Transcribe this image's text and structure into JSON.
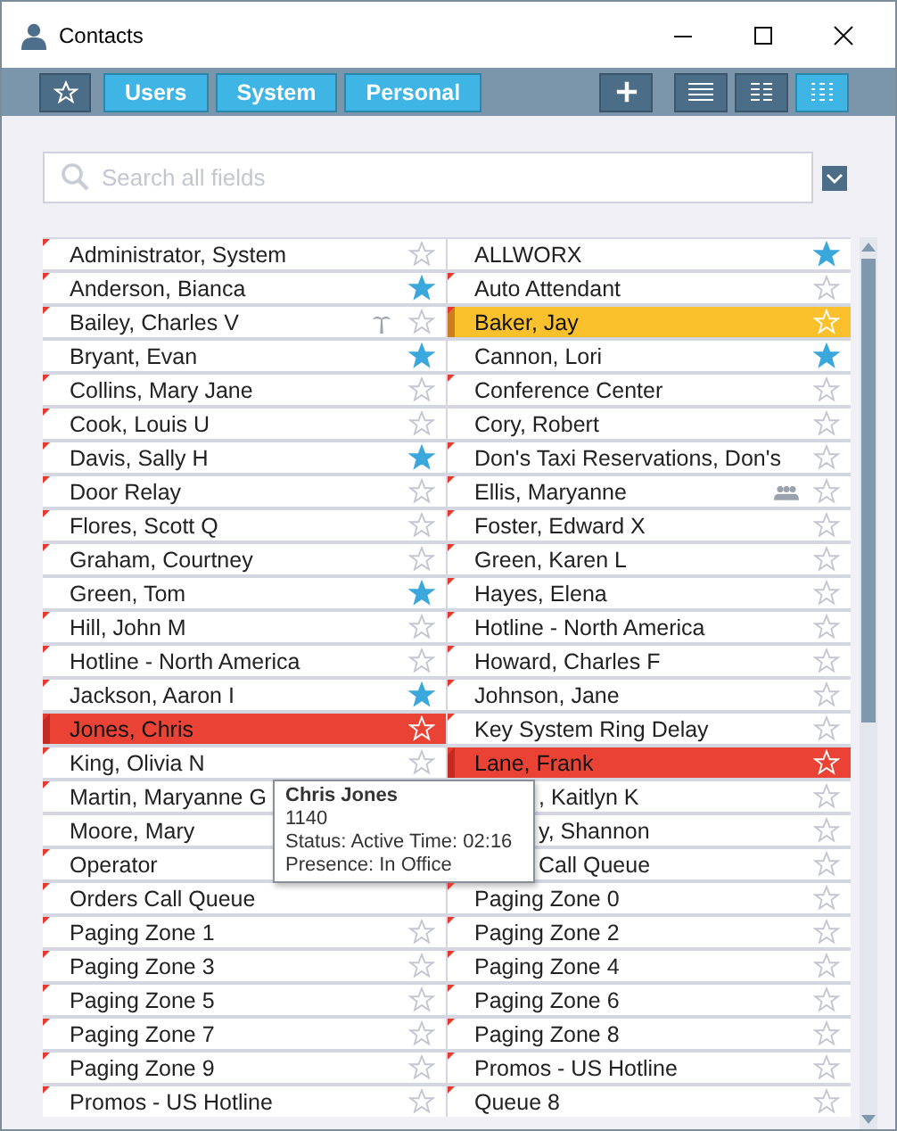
{
  "window": {
    "title": "Contacts"
  },
  "filters": {
    "favorites": {
      "selected": false
    },
    "tabs": [
      {
        "label": "Users",
        "selected": true
      },
      {
        "label": "System",
        "selected": true
      },
      {
        "label": "Personal",
        "selected": true
      }
    ]
  },
  "views": [
    {
      "kind": "list",
      "selected": false
    },
    {
      "kind": "details",
      "selected": false
    },
    {
      "kind": "grid",
      "selected": true
    }
  ],
  "search": {
    "placeholder": "Search all fields"
  },
  "columns": [
    {
      "rows": [
        {
          "name": "Administrator, System",
          "kind": "plain",
          "flag": true,
          "starred": false
        },
        {
          "name": "Anderson, Bianca",
          "kind": "plain",
          "flag": true,
          "starred": true
        },
        {
          "name": "Bailey, Charles V",
          "kind": "vacation",
          "flag": true,
          "starred": false
        },
        {
          "name": "Bryant, Evan",
          "kind": "plain",
          "flag": false,
          "starred": true
        },
        {
          "name": "Collins, Mary Jane",
          "kind": "plain",
          "flag": true,
          "starred": false
        },
        {
          "name": "Cook, Louis U",
          "kind": "plain",
          "flag": true,
          "starred": false
        },
        {
          "name": "Davis, Sally H",
          "kind": "plain",
          "flag": true,
          "starred": true
        },
        {
          "name": "Door Relay",
          "kind": "plain",
          "flag": true,
          "starred": false
        },
        {
          "name": "Flores, Scott Q",
          "kind": "plain",
          "flag": true,
          "starred": false
        },
        {
          "name": "Graham, Courtney",
          "kind": "plain",
          "flag": true,
          "starred": false
        },
        {
          "name": "Green, Tom",
          "kind": "plain",
          "flag": false,
          "starred": true
        },
        {
          "name": "Hill, John M",
          "kind": "plain",
          "flag": true,
          "starred": false
        },
        {
          "name": "Hotline - North America",
          "kind": "plain",
          "flag": true,
          "starred": false
        },
        {
          "name": "Jackson, Aaron I",
          "kind": "plain",
          "flag": true,
          "starred": true
        },
        {
          "name": "Jones, Chris",
          "kind": "plain",
          "flag": true,
          "color": "#ea4335",
          "starred": false
        },
        {
          "name": "King, Olivia N",
          "kind": "plain",
          "flag": true,
          "starred": false
        },
        {
          "name": "Martin, Maryanne G",
          "kind": "plain",
          "flag": true
        },
        {
          "name": "Moore, Mary",
          "kind": "plain",
          "flag": false
        },
        {
          "name": "Operator",
          "kind": "plain",
          "flag": true
        },
        {
          "name": "Orders Call Queue",
          "kind": "plain",
          "flag": true
        },
        {
          "name": "Paging Zone 1",
          "kind": "plain",
          "flag": true,
          "starred": false
        },
        {
          "name": "Paging Zone 3",
          "kind": "plain",
          "flag": true,
          "starred": false
        },
        {
          "name": "Paging Zone 5",
          "kind": "plain",
          "flag": true,
          "starred": false
        },
        {
          "name": "Paging Zone 7",
          "kind": "plain",
          "flag": true,
          "starred": false
        },
        {
          "name": "Paging Zone 9",
          "kind": "plain",
          "flag": true,
          "starred": false
        },
        {
          "name": "Promos - US Hotline",
          "kind": "plain",
          "flag": true,
          "starred": false
        }
      ]
    },
    {
      "rows": [
        {
          "name": "ALLWORX",
          "kind": "plain",
          "flag": false,
          "starred": true
        },
        {
          "name": "Auto Attendant",
          "kind": "plain",
          "flag": true,
          "starred": false
        },
        {
          "name": "Baker, Jay",
          "kind": "plain",
          "flag": true,
          "color": "#fbc12d",
          "starred": false
        },
        {
          "name": "Cannon, Lori",
          "kind": "plain",
          "flag": false,
          "starred": true
        },
        {
          "name": "Conference Center",
          "kind": "plain",
          "flag": true,
          "starred": false
        },
        {
          "name": "Cory, Robert",
          "kind": "plain",
          "flag": false,
          "starred": false
        },
        {
          "name": "Don's Taxi Reservations, Don's",
          "kind": "plain",
          "flag": true,
          "starred": false
        },
        {
          "name": "Ellis, Maryanne",
          "kind": "group",
          "flag": true,
          "starred": false
        },
        {
          "name": "Foster, Edward X",
          "kind": "plain",
          "flag": true,
          "starred": false
        },
        {
          "name": "Green, Karen L",
          "kind": "plain",
          "flag": true,
          "starred": false
        },
        {
          "name": "Hayes, Elena",
          "kind": "plain",
          "flag": true,
          "starred": false
        },
        {
          "name": "Hotline - North America",
          "kind": "plain",
          "flag": true,
          "starred": false
        },
        {
          "name": "Howard, Charles F",
          "kind": "plain",
          "flag": true,
          "starred": false
        },
        {
          "name": "Johnson, Jane",
          "kind": "plain",
          "flag": true,
          "starred": false
        },
        {
          "name": "Key System Ring Delay",
          "kind": "plain",
          "flag": true,
          "starred": false
        },
        {
          "name": "Lane, Frank",
          "kind": "plain",
          "flag": true,
          "color": "#ea4335",
          "starred": false
        },
        {
          "name": ", Kaitlyn K",
          "kind": "covered",
          "starred": false
        },
        {
          "name": "y, Shannon",
          "kind": "covered",
          "starred": false
        },
        {
          "name": "Call Queue",
          "kind": "covered",
          "starred": false
        },
        {
          "name": "Paging Zone 0",
          "kind": "plain",
          "flag": true,
          "starred": false
        },
        {
          "name": "Paging Zone 2",
          "kind": "plain",
          "flag": true,
          "starred": false
        },
        {
          "name": "Paging Zone 4",
          "kind": "plain",
          "flag": true,
          "starred": false
        },
        {
          "name": "Paging Zone 6",
          "kind": "plain",
          "flag": true,
          "starred": false
        },
        {
          "name": "Paging Zone 8",
          "kind": "plain",
          "flag": true,
          "starred": false
        },
        {
          "name": "Promos - US Hotline",
          "kind": "plain",
          "flag": true,
          "starred": false
        },
        {
          "name": "Queue 8",
          "kind": "plain",
          "flag": true,
          "starred": false
        }
      ]
    }
  ],
  "tooltip": {
    "title": "Chris Jones",
    "lines": [
      "1140",
      "Status: Active Time: 02:16",
      "Presence: In Office"
    ]
  }
}
